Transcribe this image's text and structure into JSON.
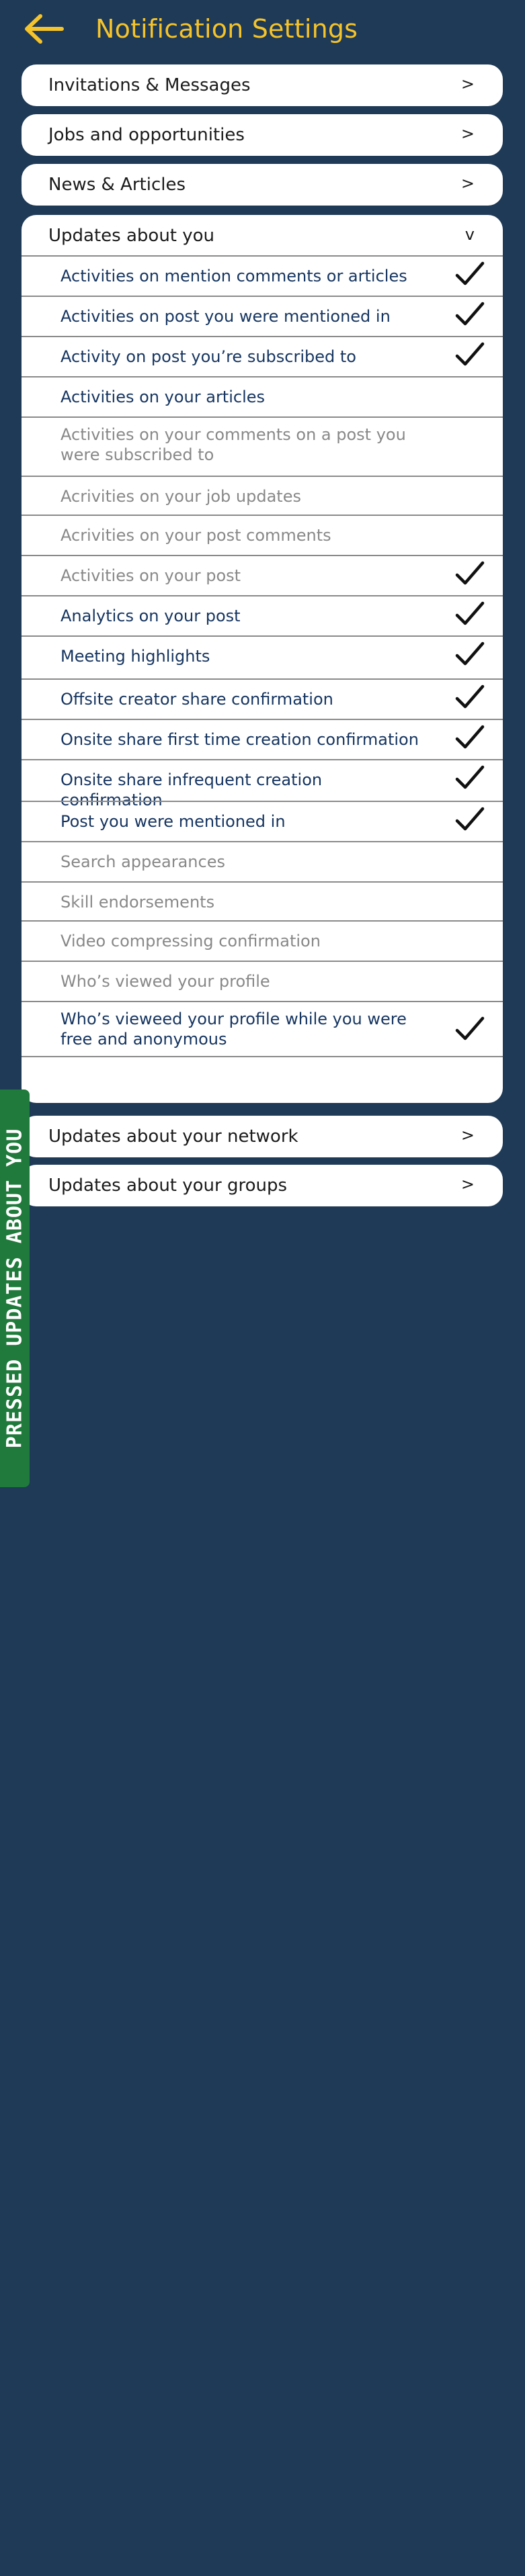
{
  "header": {
    "title": "Notification Settings",
    "back_icon": "arrow-left-icon",
    "accent_color": "#f5c32a",
    "background_color": "#1f3a56"
  },
  "sections": {
    "invitations": {
      "label": "Invitations & Messages",
      "chevron": ">"
    },
    "jobs": {
      "label": "Jobs and opportunities",
      "chevron": ">"
    },
    "news": {
      "label": "News & Articles",
      "chevron": ">"
    },
    "updates_about_you": {
      "label": "Updates about you",
      "chevron": "v",
      "items": [
        {
          "label": "Activities on mention comments or articles",
          "checked": true,
          "active": true
        },
        {
          "label": "Activities on post you were mentioned in",
          "checked": true,
          "active": true
        },
        {
          "label": "Activity on post you’re subscribed to",
          "checked": true,
          "active": true
        },
        {
          "label": "Activities on your articles",
          "checked": false,
          "active": true
        },
        {
          "label": "Activities on your comments on a post you were subscribed to",
          "checked": false,
          "active": false
        },
        {
          "label": "Acrivities on your job updates",
          "checked": false,
          "active": false
        },
        {
          "label": "Acrivities on your post comments",
          "checked": false,
          "active": false
        },
        {
          "label": "Activities on your post",
          "checked": true,
          "active": false
        },
        {
          "label": "Analytics on your post",
          "checked": true,
          "active": true
        },
        {
          "label": "Meeting highlights",
          "checked": true,
          "active": true
        },
        {
          "label": "Offsite creator share confirmation",
          "checked": true,
          "active": true
        },
        {
          "label": "Onsite share first time creation confirmation",
          "checked": true,
          "active": true
        },
        {
          "label": "Onsite share infrequent creation confirmation",
          "checked": true,
          "active": true
        },
        {
          "label": "Post you were mentioned in",
          "checked": true,
          "active": true
        },
        {
          "label": "Search appearances",
          "checked": false,
          "active": false
        },
        {
          "label": "Skill endorsements",
          "checked": false,
          "active": false
        },
        {
          "label": "Video compressing confirmation",
          "checked": false,
          "active": false
        },
        {
          "label": "Who’s viewed your profile",
          "checked": false,
          "active": false
        },
        {
          "label": "Who’s vieweed your profile while you were free and anonymous",
          "checked": true,
          "active": true
        }
      ]
    },
    "network": {
      "label": "Updates about your network",
      "chevron": ">"
    },
    "groups": {
      "label": "Updates about your groups",
      "chevron": ">"
    }
  },
  "side_tab": {
    "label": "PRESSED UPDATES ABOUT YOU",
    "color": "#1f7a3b"
  },
  "colors": {
    "active_text": "#163560",
    "inactive_text": "#888888",
    "check": "#111111"
  }
}
